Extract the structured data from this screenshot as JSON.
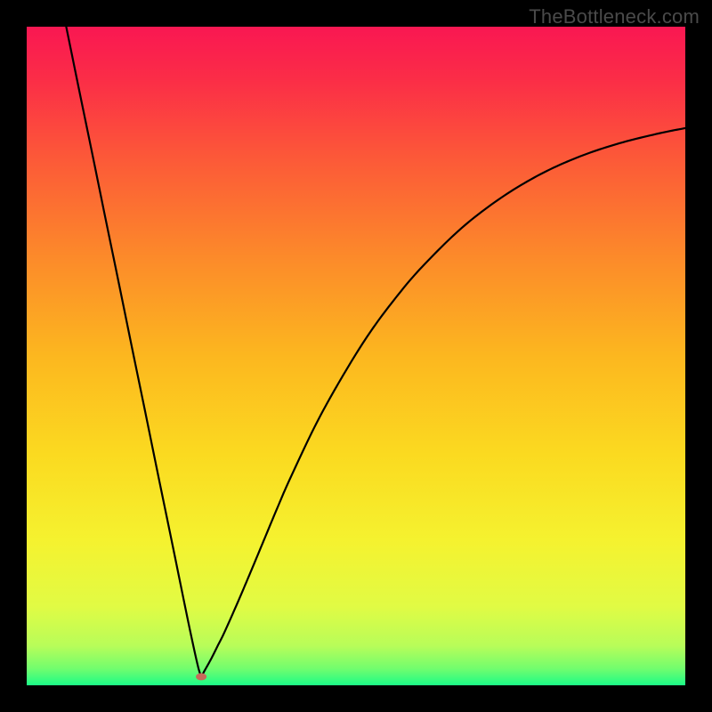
{
  "watermark": "TheBottleneck.com",
  "chart_data": {
    "type": "line",
    "title": "",
    "xlabel": "",
    "ylabel": "",
    "xlim": [
      0,
      100
    ],
    "ylim": [
      0,
      100
    ],
    "grid": false,
    "legend": false,
    "background_gradient": [
      {
        "stop": 0.0,
        "color": "#f91752"
      },
      {
        "stop": 0.08,
        "color": "#fb2d47"
      },
      {
        "stop": 0.2,
        "color": "#fc5938"
      },
      {
        "stop": 0.35,
        "color": "#fc8a2a"
      },
      {
        "stop": 0.5,
        "color": "#fcb71f"
      },
      {
        "stop": 0.65,
        "color": "#fbda20"
      },
      {
        "stop": 0.78,
        "color": "#f5f22f"
      },
      {
        "stop": 0.88,
        "color": "#e1fb44"
      },
      {
        "stop": 0.94,
        "color": "#b8fd59"
      },
      {
        "stop": 0.975,
        "color": "#71fd6e"
      },
      {
        "stop": 1.0,
        "color": "#1cfb87"
      }
    ],
    "series": [
      {
        "name": "bottleneck-curve",
        "optimum_x": 26.5,
        "x": [
          6,
          8,
          10,
          12,
          14,
          16,
          18,
          20,
          22,
          24,
          25,
          26,
          26.5,
          27,
          28,
          29,
          30,
          32,
          34,
          36,
          38,
          40,
          44,
          48,
          52,
          56,
          60,
          66,
          72,
          78,
          84,
          90,
          96,
          100
        ],
        "values": [
          100,
          90.2,
          80.5,
          70.7,
          61.0,
          51.2,
          41.5,
          31.7,
          22.0,
          12.2,
          7.4,
          2.9,
          1.3,
          2.2,
          4.0,
          6.0,
          8.0,
          12.5,
          17.2,
          22.0,
          26.8,
          31.4,
          39.8,
          47.0,
          53.4,
          58.8,
          63.5,
          69.4,
          74.0,
          77.6,
          80.3,
          82.3,
          83.8,
          84.6
        ]
      }
    ],
    "marker": {
      "x": 26.5,
      "y": 1.3,
      "color": "#c7695a",
      "rx": 6,
      "ry": 4
    }
  }
}
